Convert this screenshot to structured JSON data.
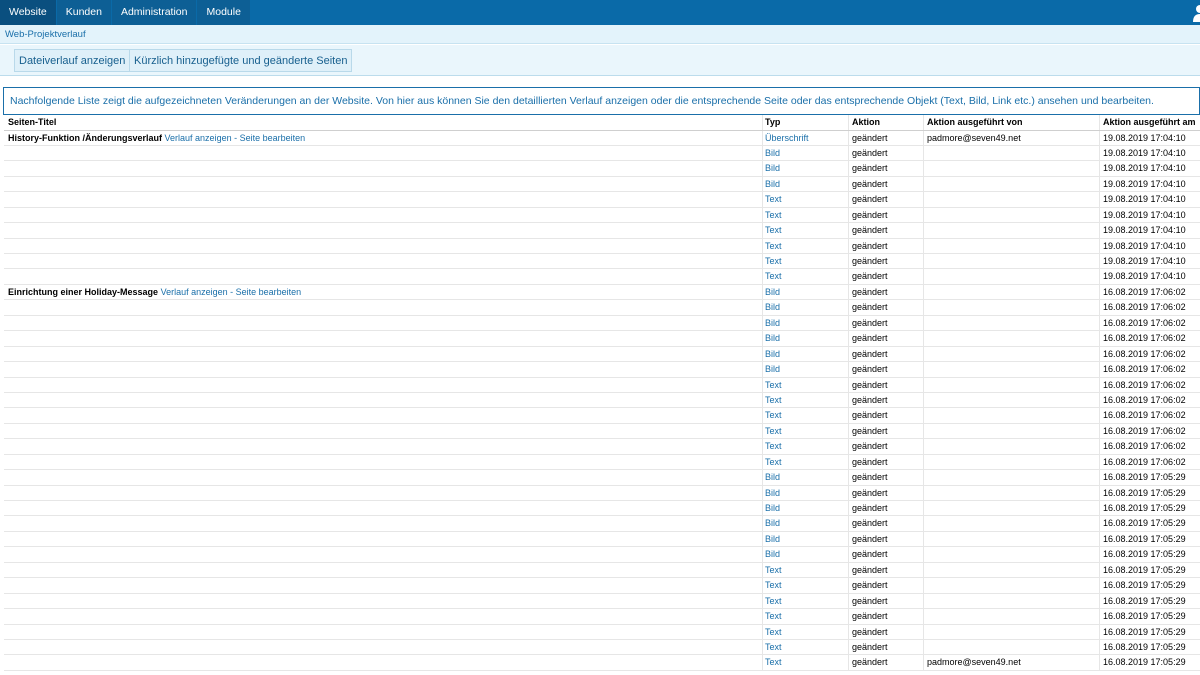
{
  "nav": {
    "tabs": [
      "Website",
      "Kunden",
      "Administration",
      "Module"
    ],
    "active_tab": "Website",
    "user_icon": "user-icon"
  },
  "breadcrumb": {
    "label": "Web-Projektverlauf"
  },
  "toolbar": {
    "file_history_label": "Dateiverlauf anzeigen",
    "recent_pages_label": "Kürzlich hinzugefügte und geänderte Seiten"
  },
  "info_text": "Nachfolgende Liste zeigt die aufgezeichneten Veränderungen an der Website. Von hier aus können Sie den detaillierten Verlauf anzeigen oder die entsprechende Seite oder das entsprechende Objekt (Text, Bild, Link etc.) ansehen und bearbeiten.",
  "table": {
    "headers": {
      "title": "Seiten-Titel",
      "typ": "Typ",
      "aktion": "Aktion",
      "von": "Aktion ausgeführt von",
      "am": "Aktion ausgeführt am"
    },
    "link_show": "Verlauf anzeigen",
    "link_sep": " - ",
    "link_edit": "Seite bearbeiten",
    "rows": [
      {
        "title": "History-Funktion /Änderungsverlauf",
        "typ": "Überschrift",
        "aktion": "geändert",
        "von": "padmore@seven49.net",
        "am": "19.08.2019 17:04:10"
      },
      {
        "title": "",
        "typ": "Bild",
        "aktion": "geändert",
        "von": "",
        "am": "19.08.2019 17:04:10"
      },
      {
        "title": "",
        "typ": "Bild",
        "aktion": "geändert",
        "von": "",
        "am": "19.08.2019 17:04:10"
      },
      {
        "title": "",
        "typ": "Bild",
        "aktion": "geändert",
        "von": "",
        "am": "19.08.2019 17:04:10"
      },
      {
        "title": "",
        "typ": "Text",
        "aktion": "geändert",
        "von": "",
        "am": "19.08.2019 17:04:10"
      },
      {
        "title": "",
        "typ": "Text",
        "aktion": "geändert",
        "von": "",
        "am": "19.08.2019 17:04:10"
      },
      {
        "title": "",
        "typ": "Text",
        "aktion": "geändert",
        "von": "",
        "am": "19.08.2019 17:04:10"
      },
      {
        "title": "",
        "typ": "Text",
        "aktion": "geändert",
        "von": "",
        "am": "19.08.2019 17:04:10"
      },
      {
        "title": "",
        "typ": "Text",
        "aktion": "geändert",
        "von": "",
        "am": "19.08.2019 17:04:10"
      },
      {
        "title": "",
        "typ": "Text",
        "aktion": "geändert",
        "von": "",
        "am": "19.08.2019 17:04:10"
      },
      {
        "title": "Einrichtung einer Holiday-Message",
        "typ": "Bild",
        "aktion": "geändert",
        "von": "",
        "am": "16.08.2019 17:06:02"
      },
      {
        "title": "",
        "typ": "Bild",
        "aktion": "geändert",
        "von": "",
        "am": "16.08.2019 17:06:02"
      },
      {
        "title": "",
        "typ": "Bild",
        "aktion": "geändert",
        "von": "",
        "am": "16.08.2019 17:06:02"
      },
      {
        "title": "",
        "typ": "Bild",
        "aktion": "geändert",
        "von": "",
        "am": "16.08.2019 17:06:02"
      },
      {
        "title": "",
        "typ": "Bild",
        "aktion": "geändert",
        "von": "",
        "am": "16.08.2019 17:06:02"
      },
      {
        "title": "",
        "typ": "Bild",
        "aktion": "geändert",
        "von": "",
        "am": "16.08.2019 17:06:02"
      },
      {
        "title": "",
        "typ": "Text",
        "aktion": "geändert",
        "von": "",
        "am": "16.08.2019 17:06:02"
      },
      {
        "title": "",
        "typ": "Text",
        "aktion": "geändert",
        "von": "",
        "am": "16.08.2019 17:06:02"
      },
      {
        "title": "",
        "typ": "Text",
        "aktion": "geändert",
        "von": "",
        "am": "16.08.2019 17:06:02"
      },
      {
        "title": "",
        "typ": "Text",
        "aktion": "geändert",
        "von": "",
        "am": "16.08.2019 17:06:02"
      },
      {
        "title": "",
        "typ": "Text",
        "aktion": "geändert",
        "von": "",
        "am": "16.08.2019 17:06:02"
      },
      {
        "title": "",
        "typ": "Text",
        "aktion": "geändert",
        "von": "",
        "am": "16.08.2019 17:06:02"
      },
      {
        "title": "",
        "typ": "Bild",
        "aktion": "geändert",
        "von": "",
        "am": "16.08.2019 17:05:29"
      },
      {
        "title": "",
        "typ": "Bild",
        "aktion": "geändert",
        "von": "",
        "am": "16.08.2019 17:05:29"
      },
      {
        "title": "",
        "typ": "Bild",
        "aktion": "geändert",
        "von": "",
        "am": "16.08.2019 17:05:29"
      },
      {
        "title": "",
        "typ": "Bild",
        "aktion": "geändert",
        "von": "",
        "am": "16.08.2019 17:05:29"
      },
      {
        "title": "",
        "typ": "Bild",
        "aktion": "geändert",
        "von": "",
        "am": "16.08.2019 17:05:29"
      },
      {
        "title": "",
        "typ": "Bild",
        "aktion": "geändert",
        "von": "",
        "am": "16.08.2019 17:05:29"
      },
      {
        "title": "",
        "typ": "Text",
        "aktion": "geändert",
        "von": "",
        "am": "16.08.2019 17:05:29"
      },
      {
        "title": "",
        "typ": "Text",
        "aktion": "geändert",
        "von": "",
        "am": "16.08.2019 17:05:29"
      },
      {
        "title": "",
        "typ": "Text",
        "aktion": "geändert",
        "von": "",
        "am": "16.08.2019 17:05:29"
      },
      {
        "title": "",
        "typ": "Text",
        "aktion": "geändert",
        "von": "",
        "am": "16.08.2019 17:05:29"
      },
      {
        "title": "",
        "typ": "Text",
        "aktion": "geändert",
        "von": "",
        "am": "16.08.2019 17:05:29"
      },
      {
        "title": "",
        "typ": "Text",
        "aktion": "geändert",
        "von": "",
        "am": "16.08.2019 17:05:29"
      },
      {
        "title": "",
        "typ": "Text",
        "aktion": "geändert",
        "von": "padmore@seven49.net",
        "am": "16.08.2019 17:05:29"
      }
    ]
  },
  "colors": {
    "nav_bg": "#0a6aa8",
    "link": "#1a6fa9",
    "breadcrumb_bg": "#e3f3fb"
  }
}
